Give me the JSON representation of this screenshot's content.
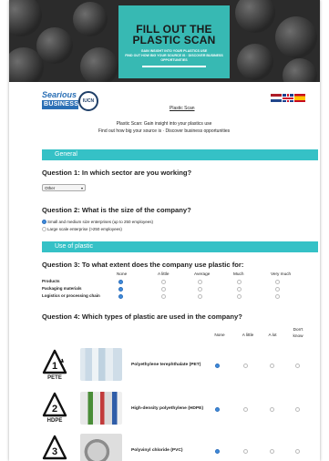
{
  "banner": {
    "title_line1": "FILL OUT THE",
    "title_line2": "PLASTIC SCAN",
    "sub_line1": "GAIN INSIGHT INTO YOUR PLASTICS USE",
    "sub_line2": "FIND OUT HOW BIG YOUR SOURCE IS",
    "sub_line3": "DISCOVER BUSINESS OPPORTUNITIES"
  },
  "header": {
    "logo_top": "Searious",
    "logo_bottom": "BUSINESS",
    "iucn": "IUCN",
    "page_title": "Plastic Scan",
    "languages": [
      "nl",
      "en",
      "es"
    ]
  },
  "intro": {
    "line1": "Plastic Scan: Gain insight into your plastics use",
    "line2": "Find out how big your source is · Discover business opportunities"
  },
  "sections": {
    "general": "General",
    "use_of_plastic": "Use of plastic"
  },
  "q1": {
    "question": "Question 1: In which sector are you working?",
    "selected": "Other"
  },
  "q2": {
    "question": "Question 2: What is the size of the company?",
    "options": [
      {
        "label": "Small and medium size enterprises (up to 250 employees)",
        "selected": true
      },
      {
        "label": "Large scale enterprise (>250 employees)",
        "selected": false
      }
    ]
  },
  "q3": {
    "question": "Question 3: To what extent does the company use plastic for:",
    "columns": [
      "None",
      "A little",
      "Average",
      "Much",
      "Very much"
    ],
    "rows": [
      {
        "label": "Products",
        "selected": 0
      },
      {
        "label": "Packaging materials",
        "selected": 0
      },
      {
        "label": "Logistics or processing chain",
        "selected": 0
      }
    ]
  },
  "q4": {
    "question": "Question 4: Which types of plastic are used in the company?",
    "columns": [
      "None",
      "A little",
      "A lot",
      "Don't know"
    ],
    "rows": [
      {
        "code_num": "1",
        "code": "PETE",
        "label": "Polyethylene terephthalate (PET)",
        "selected": 0
      },
      {
        "code_num": "2",
        "code": "HDPE",
        "label": "High-density polyethylene (HDPE)",
        "selected": 0
      },
      {
        "code_num": "3",
        "code": "",
        "label": "Polyvinyl chloride (PVC)",
        "selected": 0
      }
    ]
  },
  "colors": {
    "accent": "#35c1c6",
    "radio_selected": "#3f8bdc",
    "banner_card": "#37b9b3"
  }
}
